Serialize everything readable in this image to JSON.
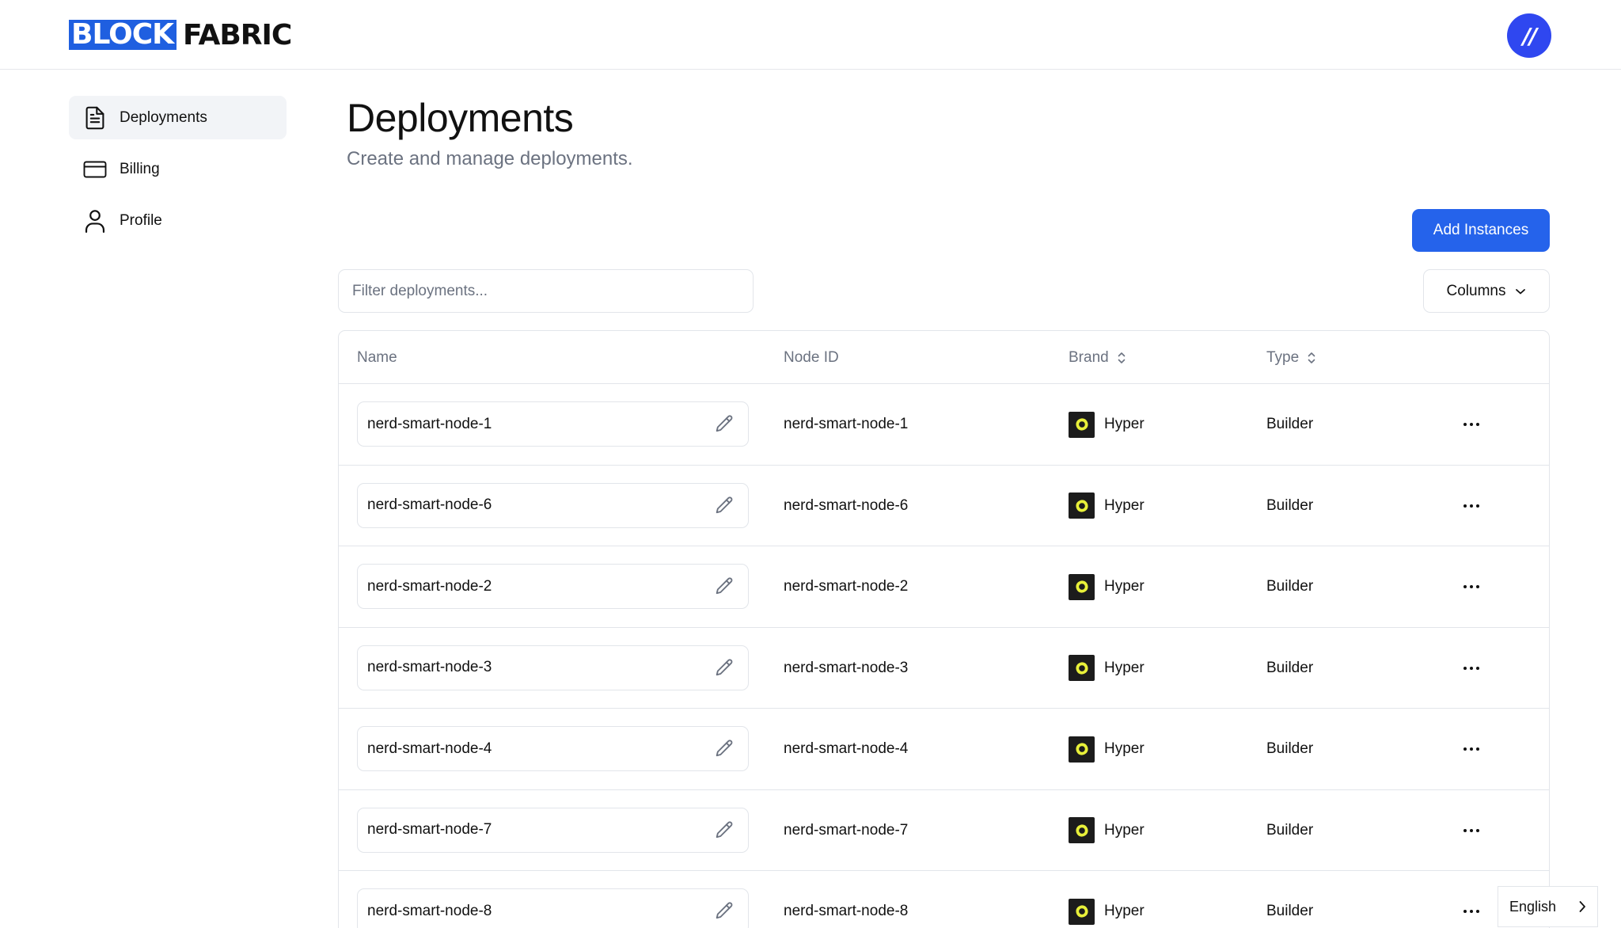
{
  "header": {
    "logo_left": "BLOCK",
    "logo_right": "FABRIC",
    "avatar_text": "//",
    "colors": {
      "logo_blue": "#1f5fe0",
      "avatar_blue": "#2f47f0"
    }
  },
  "sidebar": {
    "items": [
      {
        "label": "Deployments",
        "icon": "document-icon",
        "active": true
      },
      {
        "label": "Billing",
        "icon": "credit-card-icon",
        "active": false
      },
      {
        "label": "Profile",
        "icon": "user-icon",
        "active": false
      }
    ]
  },
  "main": {
    "title": "Deployments",
    "subtitle": "Create and manage deployments.",
    "add_button": "Add Instances",
    "filter_placeholder": "Filter deployments...",
    "columns_button": "Columns",
    "accent_color": "#2563eb"
  },
  "table": {
    "headers": {
      "name": "Name",
      "node_id": "Node ID",
      "brand": "Brand",
      "type": "Type"
    },
    "rows": [
      {
        "name": "nerd-smart-node-1",
        "node_id": "nerd-smart-node-1",
        "brand": "Hyper",
        "type": "Builder"
      },
      {
        "name": "nerd-smart-node-6",
        "node_id": "nerd-smart-node-6",
        "brand": "Hyper",
        "type": "Builder"
      },
      {
        "name": "nerd-smart-node-2",
        "node_id": "nerd-smart-node-2",
        "brand": "Hyper",
        "type": "Builder"
      },
      {
        "name": "nerd-smart-node-3",
        "node_id": "nerd-smart-node-3",
        "brand": "Hyper",
        "type": "Builder"
      },
      {
        "name": "nerd-smart-node-4",
        "node_id": "nerd-smart-node-4",
        "brand": "Hyper",
        "type": "Builder"
      },
      {
        "name": "nerd-smart-node-7",
        "node_id": "nerd-smart-node-7",
        "brand": "Hyper",
        "type": "Builder"
      },
      {
        "name": "nerd-smart-node-8",
        "node_id": "nerd-smart-node-8",
        "brand": "Hyper",
        "type": "Builder"
      }
    ]
  },
  "language": {
    "label": "English"
  }
}
